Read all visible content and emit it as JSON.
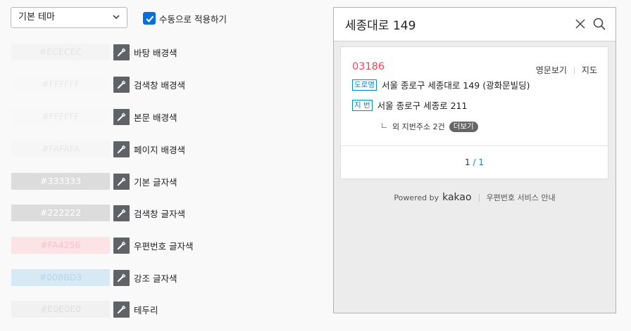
{
  "theme_select": {
    "value": "기본 테마"
  },
  "manual_apply": {
    "label": "수동으로 적용하기",
    "checked": true
  },
  "color_rows": [
    {
      "value": "#ECECEC",
      "label": "바탕 배경색",
      "bg": "#f4f4f4",
      "fg": "#e4e4e4"
    },
    {
      "value": "#FFFFFF",
      "label": "검색창 배경색",
      "bg": "#f8f8f8",
      "fg": "#e8e8e8"
    },
    {
      "value": "#FFFFFF",
      "label": "본문 배경색",
      "bg": "#f8f8f8",
      "fg": "#e8e8e8"
    },
    {
      "value": "#FAFAFA",
      "label": "페이지 배경색",
      "bg": "#f6f6f6",
      "fg": "#e6e6e6"
    },
    {
      "value": "#333333",
      "label": "기본 글자색",
      "bg": "#dcdcdc",
      "fg": "#ffffff"
    },
    {
      "value": "#222222",
      "label": "검색창 글자색",
      "bg": "#dcdcdc",
      "fg": "#ffffff"
    },
    {
      "value": "#FA4256",
      "label": "우편번호 글자색",
      "bg": "#fce3e5",
      "fg": "#f2c3c8"
    },
    {
      "value": "#008BD3",
      "label": "강조 글자색",
      "bg": "#d6e9f5",
      "fg": "#b9d6eb"
    },
    {
      "value": "#E0E0E0",
      "label": "테두리",
      "bg": "#f1f1f1",
      "fg": "#dedede"
    }
  ],
  "preview": {
    "search_query": "세종대로 149",
    "result": {
      "zipcode": "03186",
      "links": [
        "영문보기",
        "지도"
      ],
      "road_badge": "도로명",
      "road_address": "서울 종로구 세종대로 149 (광화문빌딩)",
      "jibun_badge": "지 번",
      "jibun_address": "서울 종로구 세종로 211",
      "extra_text": "외 지번주소 2건",
      "more_label": "더보기"
    },
    "pager": {
      "current": "1",
      "separator": "/",
      "total": "1"
    },
    "footer": {
      "powered_by": "Powered by",
      "brand": "kakao",
      "service_link": "우편번호 서비스 안내"
    }
  },
  "colors": {
    "accent": "#008BD3",
    "zipcode": "#FA4256",
    "checkbox": "#0A6FD6",
    "picker": "#5F6368"
  }
}
